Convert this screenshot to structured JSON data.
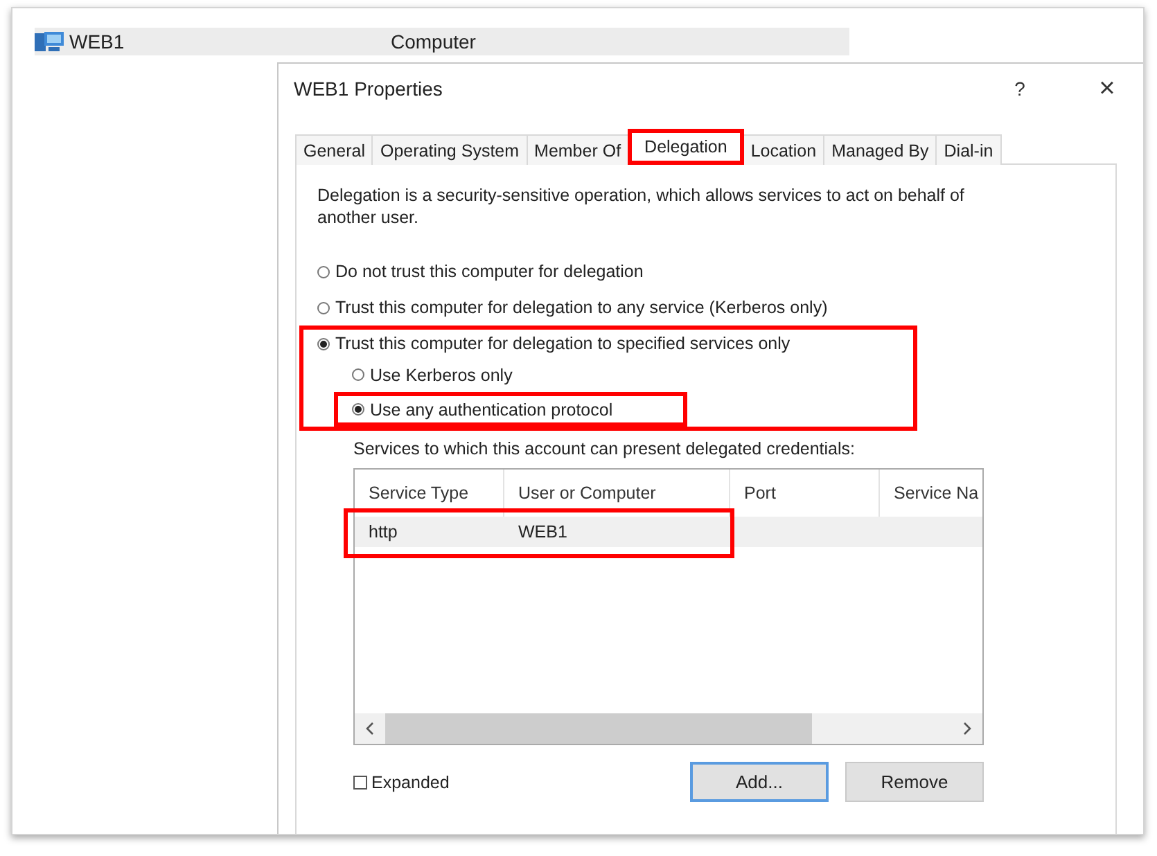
{
  "object_list": {
    "rows": [
      {
        "name": "WEB1",
        "type": "Computer"
      }
    ]
  },
  "dialog": {
    "title": "WEB1 Properties",
    "help": "?",
    "close": "×",
    "tabs": [
      {
        "label": "General",
        "selected": false,
        "highlighted": false
      },
      {
        "label": "Operating System",
        "selected": false,
        "highlighted": false
      },
      {
        "label": "Member Of",
        "selected": false,
        "highlighted": false
      },
      {
        "label": "Delegation",
        "selected": true,
        "highlighted": true
      },
      {
        "label": "Location",
        "selected": false,
        "highlighted": false
      },
      {
        "label": "Managed By",
        "selected": false,
        "highlighted": false
      },
      {
        "label": "Dial-in",
        "selected": false,
        "highlighted": false
      }
    ],
    "description": "Delegation is a security-sensitive operation, which allows services to act on behalf of another user.",
    "options": [
      {
        "label": "Do not trust this computer for delegation",
        "selected": false,
        "highlighted": false
      },
      {
        "label": "Trust this computer for delegation to any service (Kerberos only)",
        "selected": false,
        "highlighted": false
      },
      {
        "label": "Trust this computer for delegation to specified services only",
        "selected": true,
        "highlighted": true,
        "sub_options": [
          {
            "label": "Use Kerberos only",
            "selected": false,
            "highlighted": false
          },
          {
            "label": "Use any authentication protocol",
            "selected": true,
            "highlighted": true
          }
        ]
      }
    ],
    "services_label": "Services to which this account can present delegated credentials:",
    "services_table": {
      "columns": [
        "Service Type",
        "User or Computer",
        "Port",
        "Service Na"
      ],
      "rows": [
        {
          "cells": [
            "http",
            "WEB1",
            "",
            ""
          ],
          "highlighted": true
        }
      ]
    },
    "expanded": {
      "label": "Expanded",
      "checked": false
    },
    "buttons": [
      {
        "label": "Add...",
        "focused": true
      },
      {
        "label": "Remove",
        "focused": false
      }
    ]
  }
}
